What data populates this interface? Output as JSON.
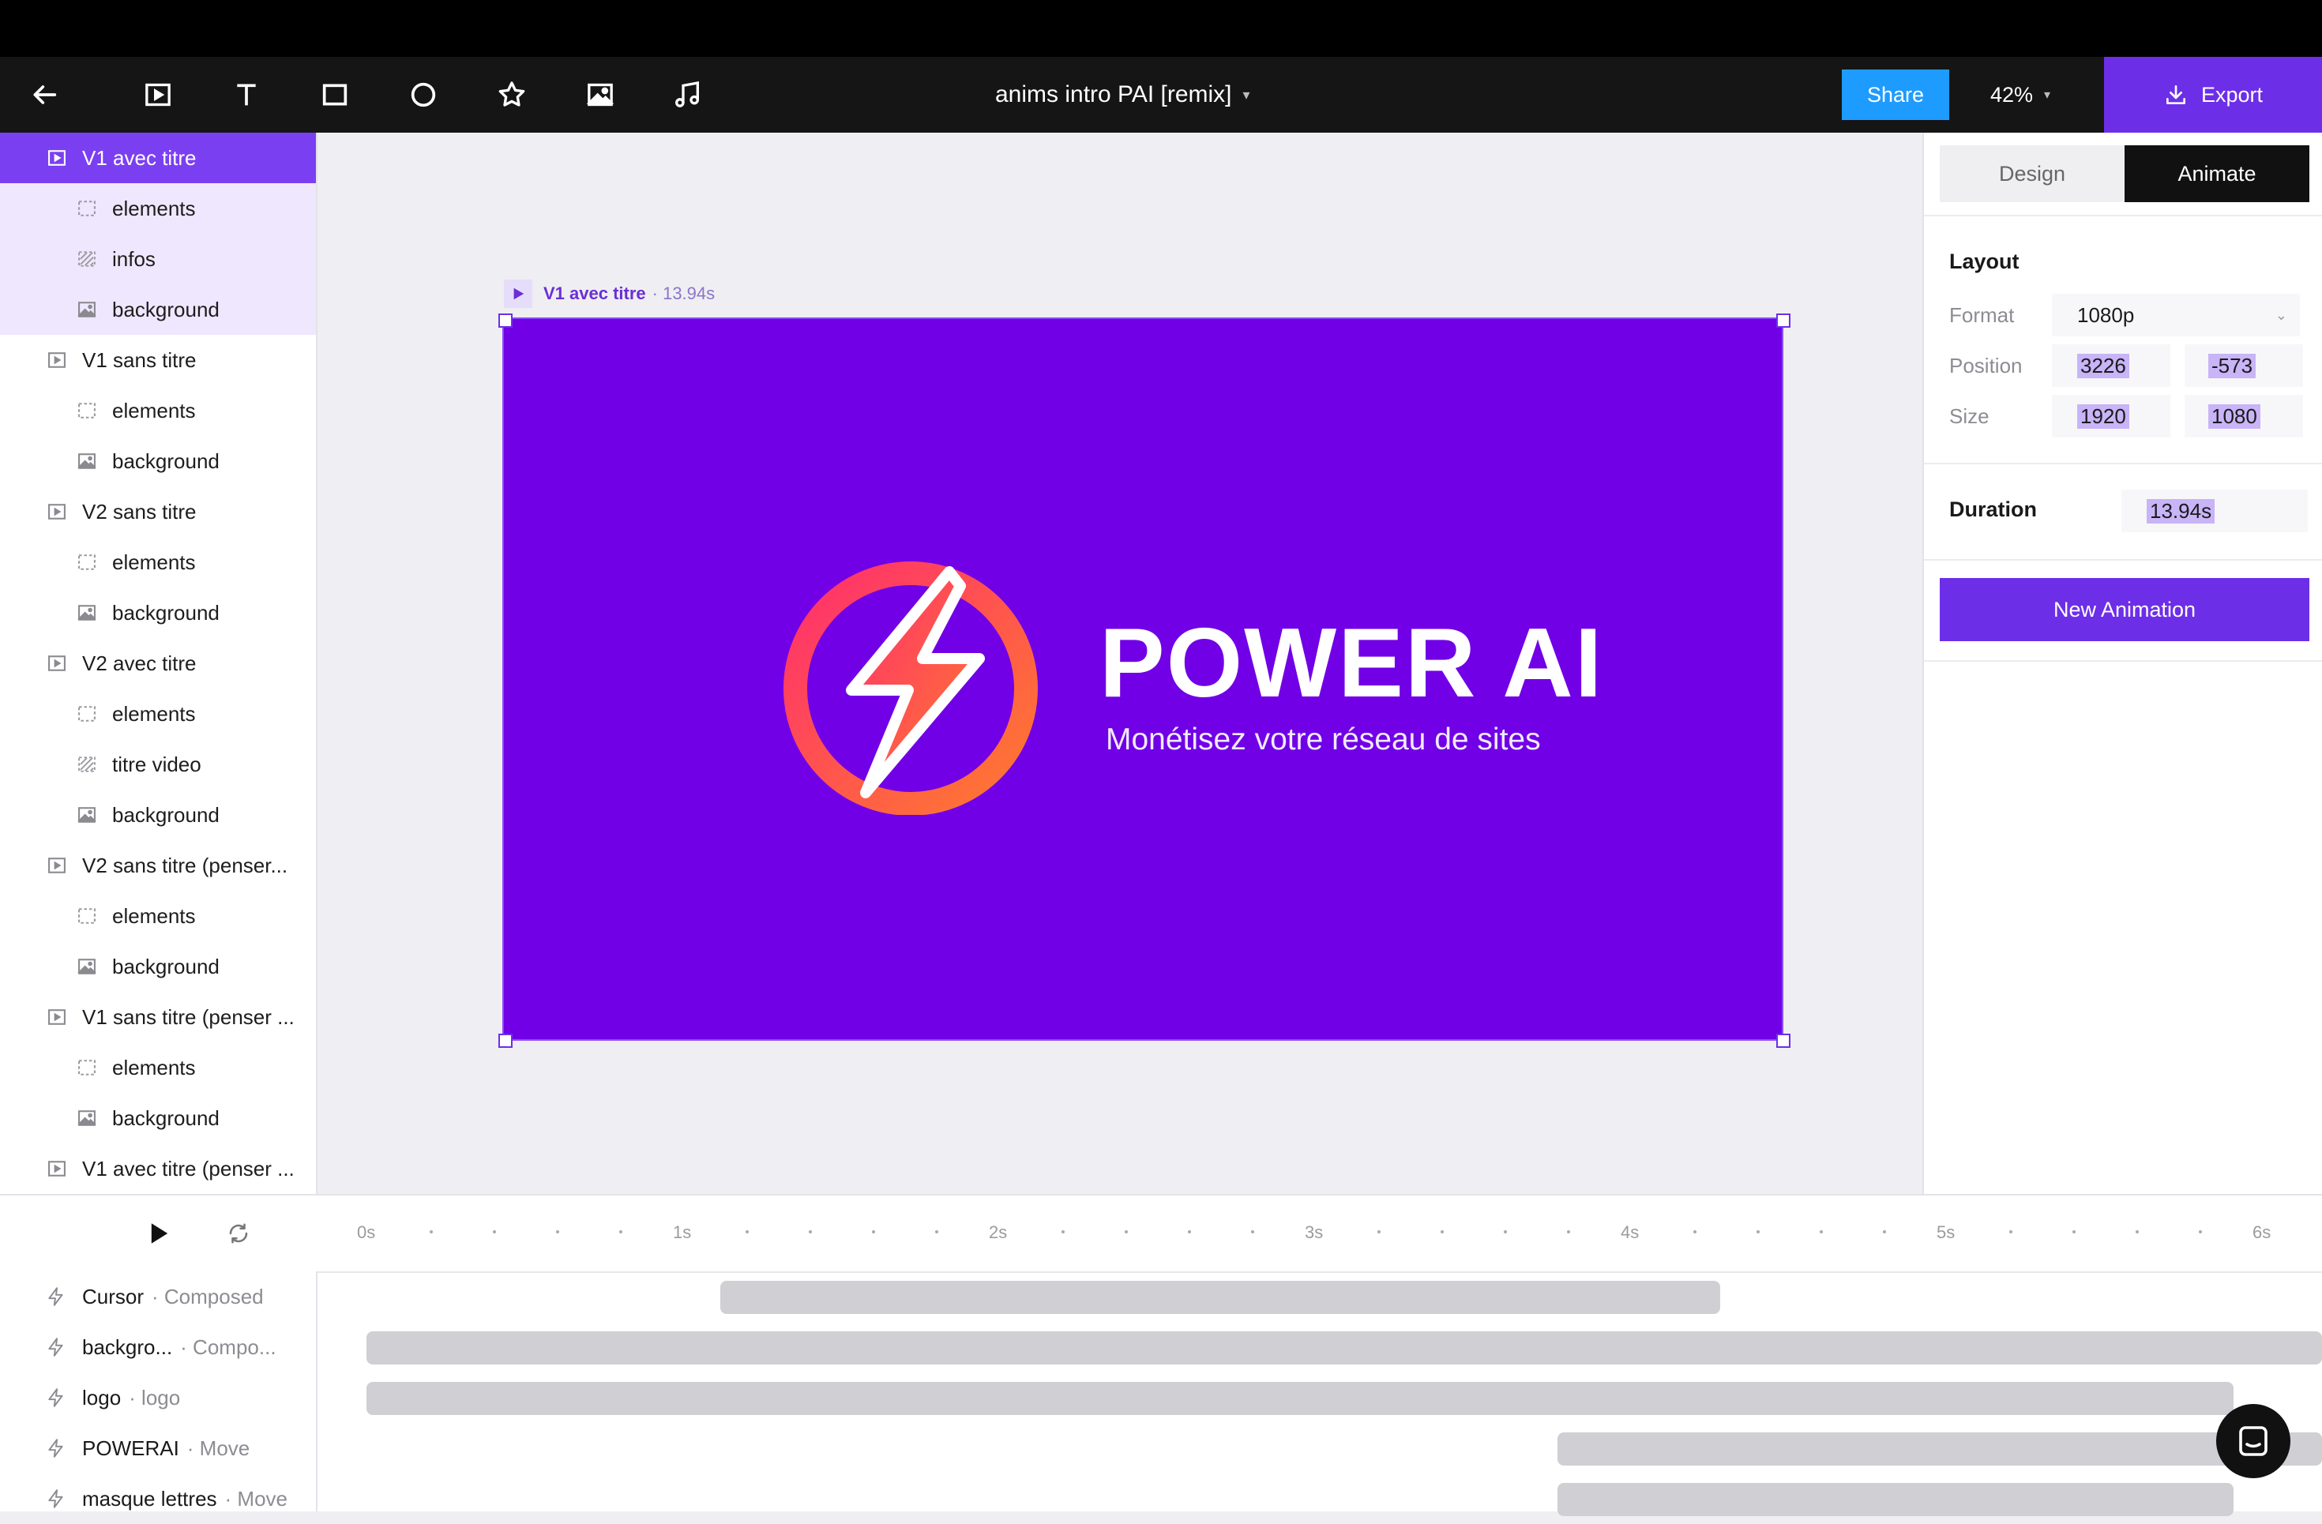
{
  "toolbar": {
    "doc_title": "anims intro PAI [remix]",
    "share_label": "Share",
    "zoom_level": "42%",
    "export_label": "Export"
  },
  "layers": [
    {
      "label": "V1 avec titre",
      "icon": "scene-icon",
      "selected": true
    },
    {
      "label": "elements",
      "icon": "group-icon"
    },
    {
      "label": "infos",
      "icon": "hatch-group-icon"
    },
    {
      "label": "background",
      "icon": "image-icon"
    },
    {
      "label": "V1 sans titre",
      "icon": "scene-icon"
    },
    {
      "label": "elements",
      "icon": "group-icon"
    },
    {
      "label": "background",
      "icon": "image-icon"
    },
    {
      "label": "V2 sans titre",
      "icon": "scene-icon"
    },
    {
      "label": "elements",
      "icon": "group-icon"
    },
    {
      "label": "background",
      "icon": "image-icon"
    },
    {
      "label": "V2 avec titre",
      "icon": "scene-icon"
    },
    {
      "label": "elements",
      "icon": "group-icon"
    },
    {
      "label": "titre video",
      "icon": "hatch-group-icon"
    },
    {
      "label": "background",
      "icon": "image-icon"
    },
    {
      "label": "V2 sans titre (penser...",
      "icon": "scene-icon"
    },
    {
      "label": "elements",
      "icon": "group-icon"
    },
    {
      "label": "background",
      "icon": "image-icon"
    },
    {
      "label": "V1 sans titre (penser ...",
      "icon": "scene-icon"
    },
    {
      "label": "elements",
      "icon": "group-icon"
    },
    {
      "label": "background",
      "icon": "image-icon"
    },
    {
      "label": "V1 avec titre (penser ...",
      "icon": "scene-icon"
    }
  ],
  "canvas": {
    "frame_name": "V1 avec titre",
    "frame_duration": "· 13.94s",
    "background_color": "#7100e6",
    "title": "POWER AI",
    "subtitle": "Monétisez votre réseau de sites"
  },
  "panel": {
    "tab_design": "Design",
    "tab_animate": "Animate",
    "layout_heading": "Layout",
    "format_label": "Format",
    "format_value": "1080p",
    "position_label": "Position",
    "position_x": "3226",
    "position_y": "-573",
    "size_label": "Size",
    "size_w": "1920",
    "size_h": "1080",
    "duration_label": "Duration",
    "duration_value": "13.94s",
    "new_animation_label": "New Animation"
  },
  "timeline": {
    "ticks": [
      "0s",
      "1s",
      "2s",
      "3s",
      "4s",
      "5s",
      "6s"
    ],
    "tracks": [
      {
        "name": "Cursor",
        "sub": "· Composed"
      },
      {
        "name": "backgro...",
        "sub": "· Compo..."
      },
      {
        "name": "logo",
        "sub": "· logo"
      },
      {
        "name": "POWERAI",
        "sub": "· Move"
      },
      {
        "name": "masque lettres",
        "sub": "· Move"
      }
    ]
  },
  "colors": {
    "accent": "#6d2ee8",
    "share": "#1e9bff",
    "selection": "#7b3ff2"
  }
}
